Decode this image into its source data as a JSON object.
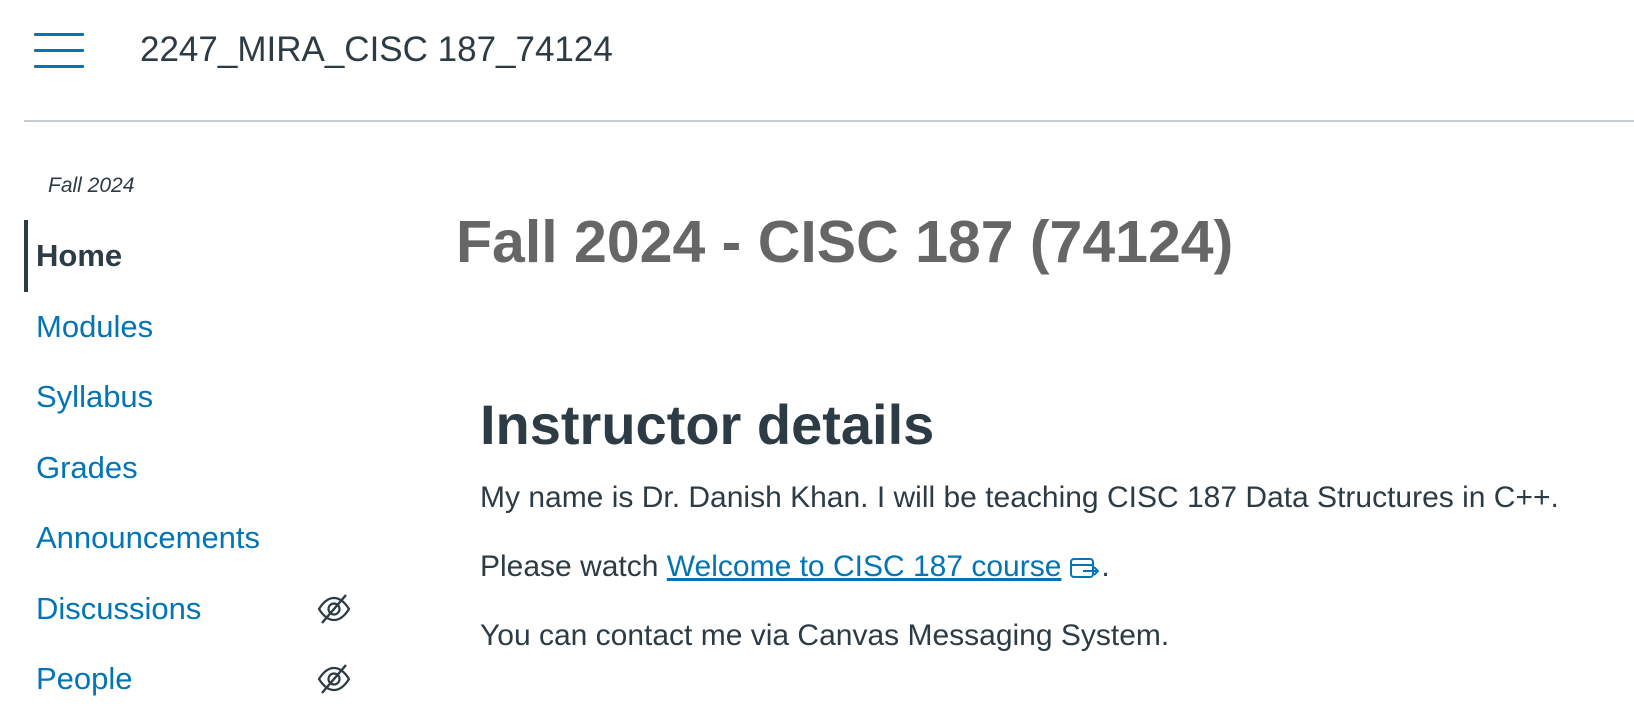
{
  "header": {
    "course_crumb": "2247_MIRA_CISC 187_74124"
  },
  "sidebar": {
    "term": "Fall 2024",
    "items": [
      {
        "label": "Home",
        "active": true,
        "hidden_from_students": false
      },
      {
        "label": "Modules",
        "active": false,
        "hidden_from_students": false
      },
      {
        "label": "Syllabus",
        "active": false,
        "hidden_from_students": false
      },
      {
        "label": "Grades",
        "active": false,
        "hidden_from_students": false
      },
      {
        "label": "Announcements",
        "active": false,
        "hidden_from_students": false
      },
      {
        "label": "Discussions",
        "active": false,
        "hidden_from_students": true
      },
      {
        "label": "People",
        "active": false,
        "hidden_from_students": true
      }
    ],
    "hidden_icon": "eye-slash-icon"
  },
  "main": {
    "page_title": "Fall 2024 - CISC 187 (74124)",
    "section_title": "Instructor details",
    "paragraph_1": "My name is Dr. Danish Khan. I will be teaching CISC 187 Data Structures in C++.",
    "paragraph_2_prefix": "Please watch ",
    "paragraph_2_link": "Welcome to CISC 187 course",
    "paragraph_2_suffix": ".",
    "paragraph_3": "You can contact me via Canvas Messaging System.",
    "external_link_icon": "external-link-icon"
  },
  "colors": {
    "link": "#0374b5",
    "text": "#2d3b45",
    "title_gray": "#666666",
    "divider": "#c7cdd1"
  }
}
